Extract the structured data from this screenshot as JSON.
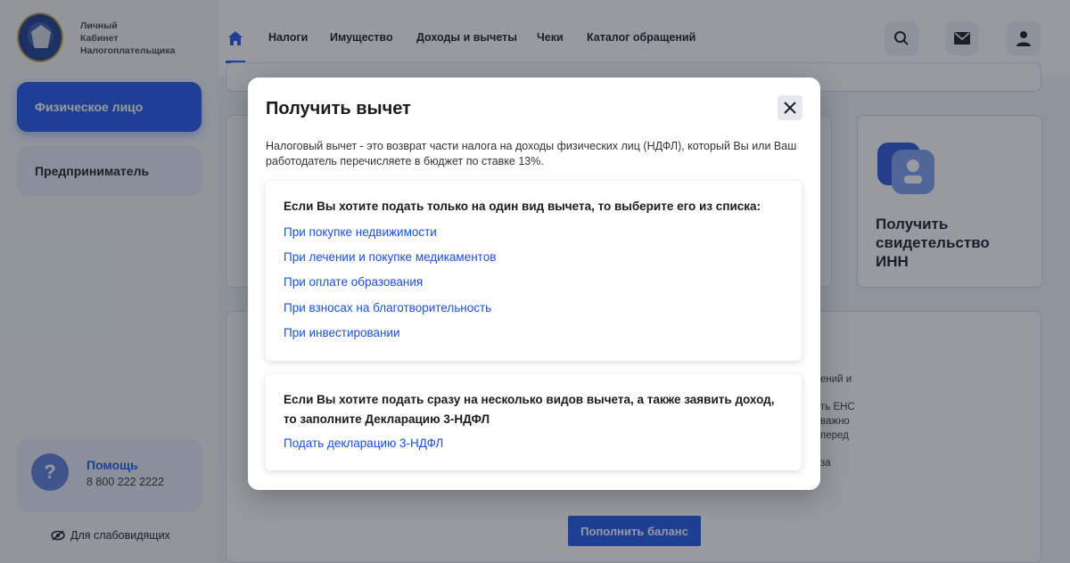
{
  "brand": {
    "line1": "Личный",
    "line2": "Кабинет",
    "line3": "Налогоплательщика"
  },
  "sidebar": {
    "items": [
      {
        "label": "Физическое лицо",
        "active": true
      },
      {
        "label": "Предприниматель",
        "active": false
      }
    ],
    "help": {
      "title": "Помощь",
      "phone": "8 800 222 2222"
    },
    "low_vision_label": "Для слабовидящих"
  },
  "topnav": {
    "items": [
      "Налоги",
      "Имущество",
      "Доходы и вычеты",
      "Чеки",
      "Каталог обращений"
    ]
  },
  "background": {
    "inn_card_title_lines": [
      "Получить",
      "свидетельство",
      "ИНН"
    ],
    "partial_text": [
      "ений и",
      "ть ЕНС",
      "важно",
      "перед",
      "за"
    ],
    "pay_button_label": "Пополнить баланс"
  },
  "modal": {
    "title": "Получить вычет",
    "description": "Налоговый вычет - это возврат части налога на доходы физических лиц (НДФЛ), который Вы или Ваш работодатель перечисляете в бюджет по ставке 13%.",
    "single": {
      "heading": "Если Вы хотите подать только на один вид вычета, то выберите его из списка:",
      "links": [
        "При покупке недвижимости",
        "При лечении и покупке медикаментов",
        "При оплате образования",
        "При взносах на благотворительность",
        "При инвестировании"
      ]
    },
    "multiple": {
      "heading": "Если Вы хотите подать сразу на несколько видов вычета, а также заявить доход, то заполните Декларацию 3-НДФЛ",
      "link": "Подать декларацию 3-НДФЛ"
    }
  },
  "colors": {
    "accent": "#2157e8",
    "link": "#1a4fe0",
    "overlay": "rgba(28,34,48,0.46)"
  }
}
